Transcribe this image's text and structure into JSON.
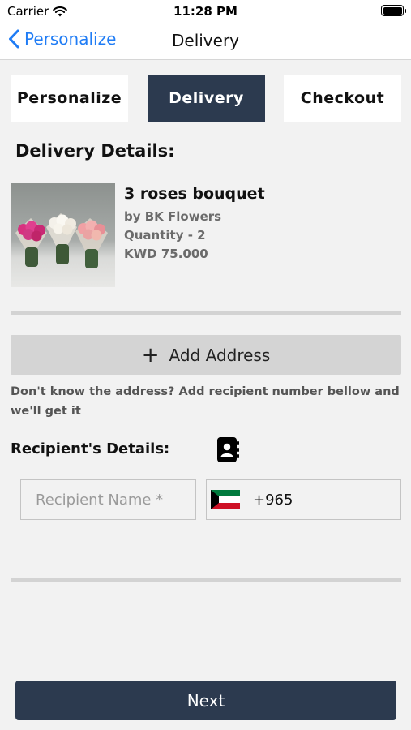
{
  "status_bar": {
    "carrier": "Carrier",
    "time": "11:28 PM"
  },
  "nav": {
    "back_label": "Personalize",
    "title": "Delivery"
  },
  "steps": [
    {
      "label": "Personalize",
      "active": false
    },
    {
      "label": "Delivery",
      "active": true
    },
    {
      "label": "Checkout",
      "active": false
    }
  ],
  "delivery": {
    "section_title": "Delivery Details:",
    "product": {
      "name": "3 roses bouquet",
      "vendor": "by BK Flowers",
      "quantity": "Quantity - 2",
      "price": "KWD 75.000"
    },
    "add_address_label": "Add Address",
    "hint": "Don't know the address? Add recipient number bellow and we'll get it"
  },
  "recipient": {
    "title": "Recipient's Details:",
    "name_placeholder": "Recipient Name *",
    "phone_code": "+965",
    "flag_icon": "kuwait-flag-icon"
  },
  "footer": {
    "next_label": "Next"
  },
  "colors": {
    "accent": "#2c3a4f",
    "link": "#1f7cf5",
    "background": "#f2f2f2"
  }
}
